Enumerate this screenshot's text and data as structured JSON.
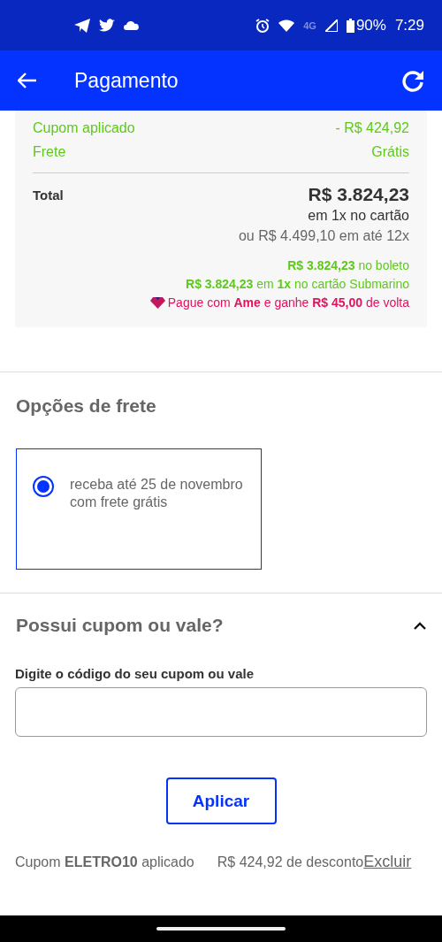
{
  "status_bar": {
    "network": "4G",
    "battery": "90%",
    "time": "7:29"
  },
  "app_bar": {
    "title": "Pagamento"
  },
  "summary": {
    "rows": [
      {
        "label": "Cupom aplicado",
        "value": "- R$ 424,92"
      },
      {
        "label": "Frete",
        "value": "Grátis"
      }
    ],
    "total_label": "Total",
    "total_value": "R$ 3.824,23",
    "total_note": "em 1x no cartão",
    "installments": "ou R$ 4.499,10 em até 12x",
    "offers": [
      {
        "kind": "green",
        "text": "**R$ 3.824,23** no boleto"
      },
      {
        "kind": "green",
        "text": "**R$ 3.824,23** em **1x** no cartão Submarino"
      },
      {
        "kind": "ame",
        "text": "Pague com **Ame** e ganhe **R$ 45,00** de volta"
      }
    ]
  },
  "shipping": {
    "title": "Opções de frete",
    "options": [
      {
        "label": "receba até 25 de novembro com frete grátis",
        "selected": true
      }
    ]
  },
  "coupon": {
    "title": "Possui cupom ou vale?",
    "expanded": true,
    "field_label": "Digite o código do seu cupom ou vale",
    "button": "Aplicar",
    "applied": "Cupom **ELETRO10** aplicado",
    "discount": "R$ 424,92 de desconto",
    "remove": "Excluir"
  }
}
